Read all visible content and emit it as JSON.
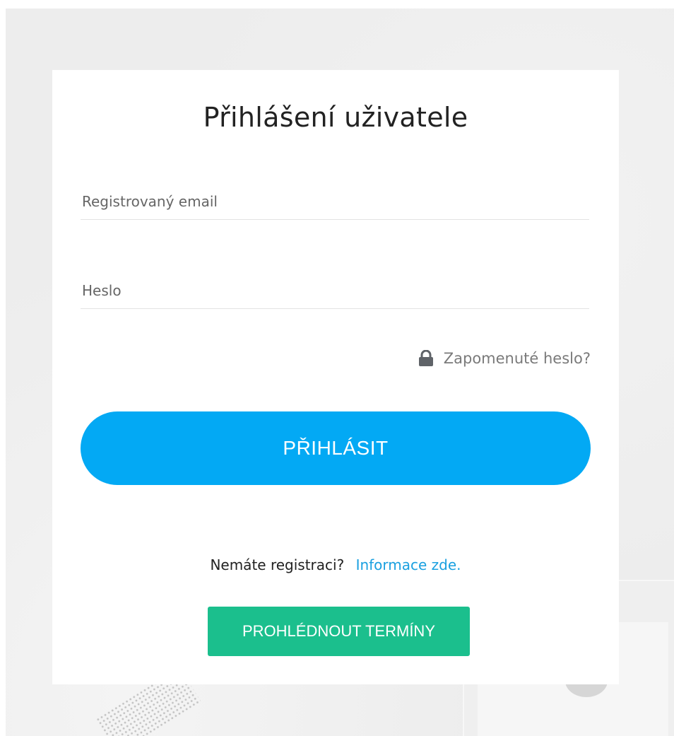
{
  "login": {
    "title": "Přihlášení uživatele",
    "email_placeholder": "Registrovaný email",
    "password_placeholder": "Heslo",
    "forgot_label": "Zapomenuté heslo?",
    "forgot_icon": "lock-icon",
    "submit_label": "PŘIHLÁSIT",
    "register_text": "Nemáte registraci?",
    "register_link": "Informace zde.",
    "terms_label": "PROHLÉDNOUT TERMÍNY"
  },
  "colors": {
    "primary": "#03a9f4",
    "success": "#1bbf8d",
    "link": "#1aa0e0",
    "background": "#ededed",
    "card": "#ffffff"
  }
}
